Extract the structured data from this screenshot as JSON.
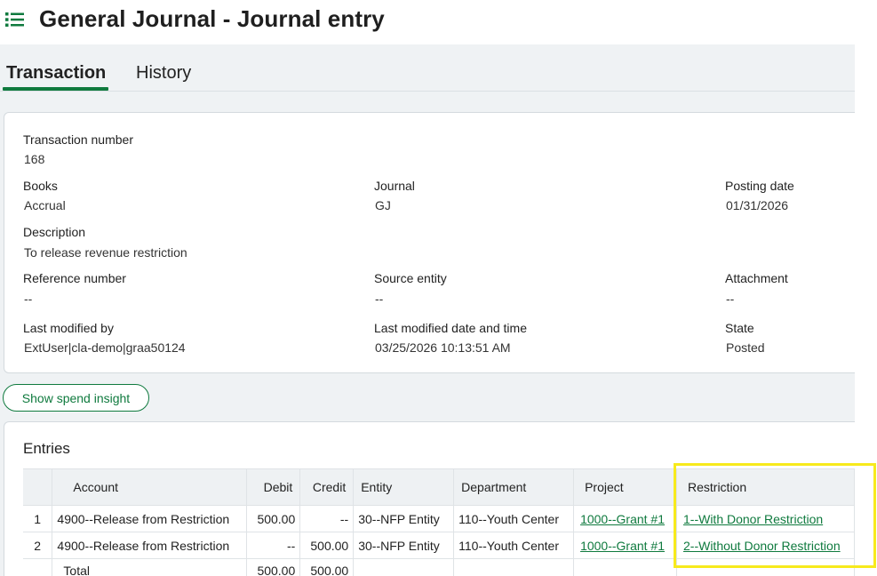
{
  "header": {
    "title": "General Journal - Journal entry",
    "menu_icon": "list-menu-icon"
  },
  "tabs": [
    {
      "label": "Transaction",
      "active": true
    },
    {
      "label": "History",
      "active": false
    }
  ],
  "transaction": {
    "transaction_number": {
      "label": "Transaction number",
      "value": "168"
    },
    "books": {
      "label": "Books",
      "value": "Accrual"
    },
    "journal": {
      "label": "Journal",
      "value": "GJ"
    },
    "posting_date": {
      "label": "Posting date",
      "value": "01/31/2026"
    },
    "description": {
      "label": "Description",
      "value": "To release revenue restriction"
    },
    "reference_number": {
      "label": "Reference number",
      "value": "--"
    },
    "source_entity": {
      "label": "Source entity",
      "value": "--"
    },
    "attachment": {
      "label": "Attachment",
      "value": "--"
    },
    "last_modified_by": {
      "label": "Last modified by",
      "value": "ExtUser|cla-demo|graa50124"
    },
    "last_modified_date": {
      "label": "Last modified date and time",
      "value": "03/25/2026 10:13:51 AM"
    },
    "state": {
      "label": "State",
      "value": "Posted"
    }
  },
  "spend_insight_label": "Show spend insight",
  "entries": {
    "title": "Entries",
    "columns": [
      "Account",
      "Debit",
      "Credit",
      "Entity",
      "Department",
      "Project",
      "Restriction"
    ],
    "rows": [
      {
        "num": "1",
        "account": "4900--Release from Restriction",
        "debit": "500.00",
        "credit": "--",
        "entity": "30--NFP Entity",
        "department": "110--Youth Center",
        "project": "1000--Grant #1",
        "restriction": "1--With Donor Restriction"
      },
      {
        "num": "2",
        "account": "4900--Release from Restriction",
        "debit": "--",
        "credit": "500.00",
        "entity": "30--NFP Entity",
        "department": "110--Youth Center",
        "project": "1000--Grant #1",
        "restriction": "2--Without Donor Restriction"
      }
    ],
    "total": {
      "label": "Total",
      "debit": "500.00",
      "credit": "500.00"
    }
  },
  "colors": {
    "accent_green": "#0f7a3e",
    "highlight_yellow": "#f7ea1c"
  }
}
